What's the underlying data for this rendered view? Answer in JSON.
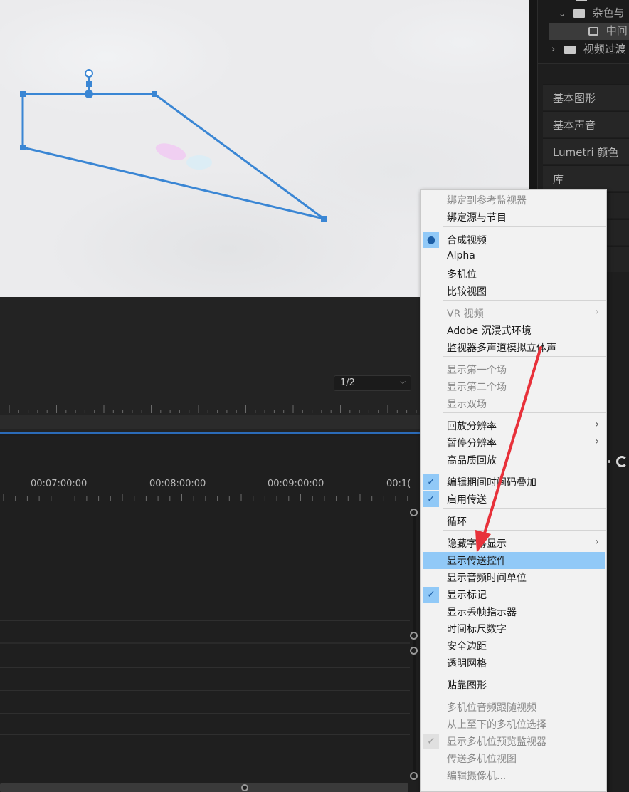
{
  "project_tree": {
    "items": [
      {
        "label": "杂色与"
      },
      {
        "label": "中间"
      },
      {
        "label": "视频过渡"
      }
    ]
  },
  "panels": {
    "tabs": [
      {
        "label": "基本图形"
      },
      {
        "label": "基本声音"
      },
      {
        "label": "Lumetri 颜色"
      },
      {
        "label": "库"
      }
    ]
  },
  "monitor": {
    "resolution": "1/2",
    "resolution_chevron": "⌵"
  },
  "timeline": {
    "timecodes": [
      "00:07:00:00",
      "00:08:00:00",
      "00:09:00:00",
      "00:1("
    ]
  },
  "context_menu": {
    "items": [
      {
        "label": "绑定到参考监视器",
        "state": "disabled"
      },
      {
        "label": "绑定源与节目",
        "state": "normal"
      },
      {
        "label": "合成视频",
        "state": "normal",
        "mark": "●"
      },
      {
        "label": "Alpha",
        "state": "normal"
      },
      {
        "label": "多机位",
        "state": "normal"
      },
      {
        "label": "比较视图",
        "state": "normal"
      },
      {
        "label": "VR 视频",
        "state": "disabled",
        "submenu": "›"
      },
      {
        "label": "Adobe 沉浸式环境",
        "state": "normal"
      },
      {
        "label": "监视器多声道模拟立体声",
        "state": "normal"
      },
      {
        "label": "显示第一个场",
        "state": "disabled"
      },
      {
        "label": "显示第二个场",
        "state": "disabled"
      },
      {
        "label": "显示双场",
        "state": "disabled"
      },
      {
        "label": "回放分辨率",
        "state": "normal",
        "submenu": "›"
      },
      {
        "label": "暂停分辨率",
        "state": "normal",
        "submenu": "›"
      },
      {
        "label": "高品质回放",
        "state": "normal"
      },
      {
        "label": "编辑期间时间码叠加",
        "state": "normal",
        "mark": "✓"
      },
      {
        "label": "启用传送",
        "state": "normal",
        "mark": "✓"
      },
      {
        "label": "循环",
        "state": "normal"
      },
      {
        "label": "隐藏字幕显示",
        "state": "normal",
        "submenu": "›"
      },
      {
        "label": "显示传送控件",
        "state": "highlighted"
      },
      {
        "label": "显示音频时间单位",
        "state": "normal"
      },
      {
        "label": "显示标记",
        "state": "normal",
        "mark": "✓"
      },
      {
        "label": "显示丢帧指示器",
        "state": "normal"
      },
      {
        "label": "时间标尺数字",
        "state": "normal"
      },
      {
        "label": "安全边距",
        "state": "normal"
      },
      {
        "label": "透明网格",
        "state": "normal"
      },
      {
        "label": "贴靠图形",
        "state": "normal"
      },
      {
        "label": "多机位音频跟随视频",
        "state": "disabled"
      },
      {
        "label": "从上至下的多机位选择",
        "state": "disabled"
      },
      {
        "label": "显示多机位预览监视器",
        "state": "disabled",
        "mark": "✓"
      },
      {
        "label": "传送多机位视图",
        "state": "disabled"
      },
      {
        "label": "编辑摄像机...",
        "state": "disabled"
      }
    ]
  },
  "colors": {
    "menu_highlight": "#91c9f7",
    "shape_outline": "#3a86d4",
    "annotation_arrow": "#e8313a"
  }
}
